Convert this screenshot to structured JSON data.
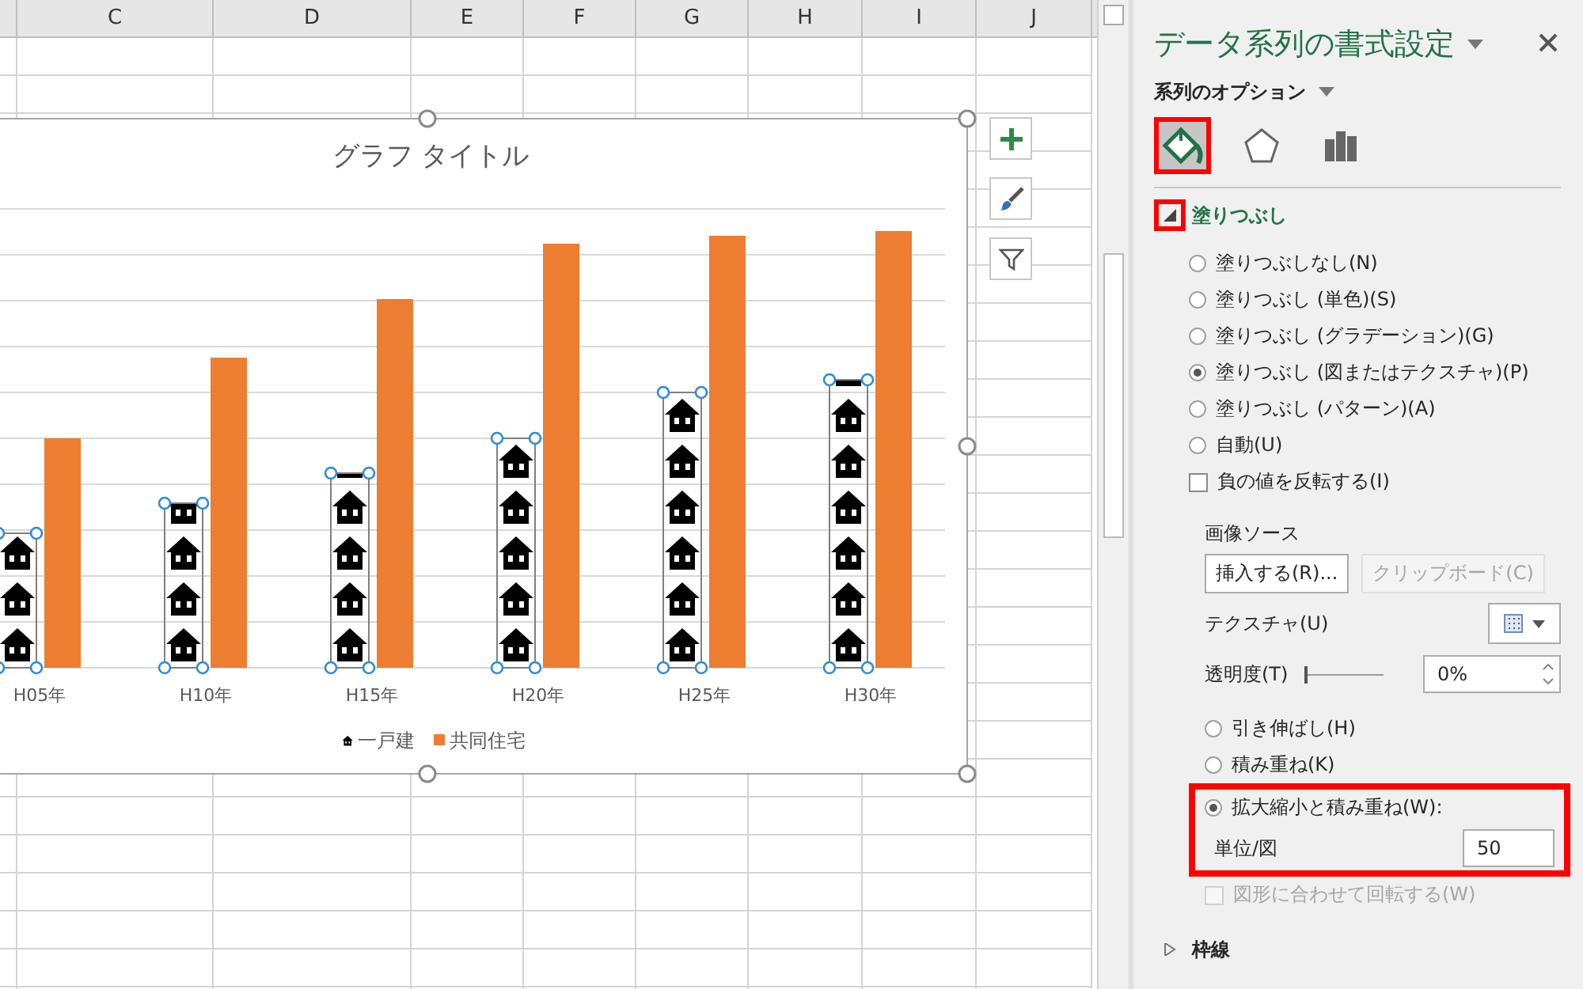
{
  "spreadsheet": {
    "columns": [
      "",
      "C",
      "D",
      "E",
      "F",
      "G",
      "H",
      "I",
      "J"
    ]
  },
  "chart": {
    "title": "グラフ タイトル",
    "categories": [
      "H05年",
      "H10年",
      "H15年",
      "H20年",
      "H25年",
      "H30年"
    ],
    "legend": [
      {
        "label": "一戸建",
        "kind": "pictogram"
      },
      {
        "label": "共同住宅",
        "kind": "bar",
        "color": "#ed7d31"
      }
    ]
  },
  "pane": {
    "title": "データ系列の書式設定",
    "options_label": "系列のオプション",
    "tabs": [
      {
        "kind": "fill",
        "selected": true,
        "highlighted": true
      },
      {
        "kind": "effects",
        "selected": false,
        "highlighted": false
      },
      {
        "kind": "series",
        "selected": false,
        "highlighted": false
      }
    ],
    "fill_section": {
      "title": "塗りつぶし",
      "expanded": true,
      "highlighted": true,
      "options": [
        {
          "label": "塗りつぶしなし(N)",
          "selected": false
        },
        {
          "label": "塗りつぶし (単色)(S)",
          "selected": false
        },
        {
          "label": "塗りつぶし (グラデーション)(G)",
          "selected": false
        },
        {
          "label": "塗りつぶし (図またはテクスチャ)(P)",
          "selected": true
        },
        {
          "label": "塗りつぶし (パターン)(A)",
          "selected": false
        },
        {
          "label": "自動(U)",
          "selected": false
        }
      ],
      "invert": {
        "label": "負の値を反転する(I)",
        "checked": false
      },
      "picture_source_label": "画像ソース",
      "buttons": [
        {
          "label": "挿入する(R)...",
          "disabled": false
        },
        {
          "label": "クリップボード(C)",
          "disabled": true
        }
      ],
      "texture_label": "テクスチャ(U)",
      "transparency": {
        "label": "透明度(T)",
        "level": 0,
        "value": "0%"
      },
      "stretch_options": [
        {
          "label": "引き伸ばし(H)",
          "selected": false,
          "highlighted": false
        },
        {
          "label": "積み重ね(K)",
          "selected": false,
          "highlighted": false
        },
        {
          "label": "拡大縮小と積み重ね(W):",
          "selected": true,
          "highlighted": true,
          "units": {
            "label": "単位/図",
            "value": "50"
          }
        }
      ],
      "rotate": {
        "label": "図形に合わせて回転する(W)",
        "checked": false,
        "disabled": true
      }
    },
    "border_section": {
      "title": "枠線",
      "expanded": false
    }
  }
}
